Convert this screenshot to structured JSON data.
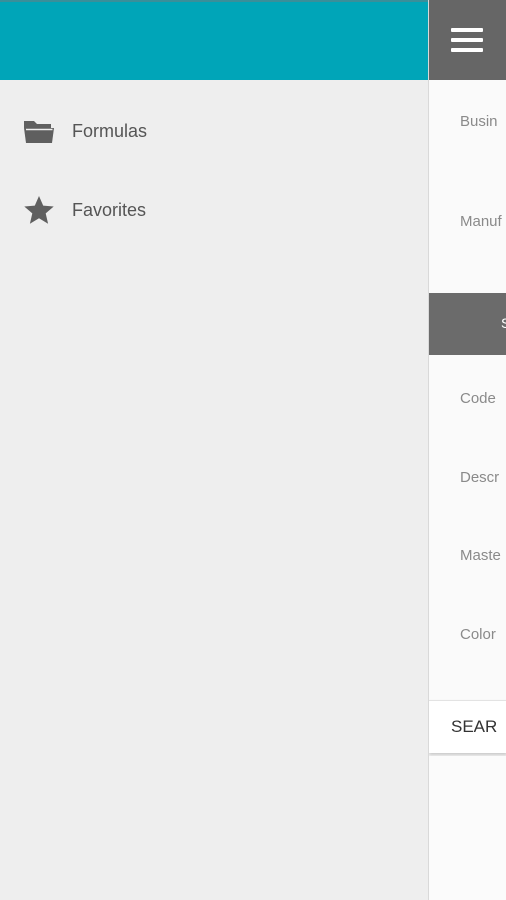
{
  "drawer": {
    "colors": {
      "header": "#00a5b8",
      "background": "#eeeeee",
      "text": "#555555",
      "icon": "#5f5f5f"
    },
    "items": [
      {
        "label": "Formulas",
        "icon": "folder-icon"
      },
      {
        "label": "Favorites",
        "icon": "star-icon"
      }
    ]
  },
  "page": {
    "menu_icon": "hamburger-icon",
    "fields": [
      {
        "label": "Busin"
      },
      {
        "label": "Manuf"
      },
      {
        "label": "Code"
      },
      {
        "label": "Descr"
      },
      {
        "label": "Maste"
      },
      {
        "label": "Color"
      }
    ],
    "section_label": "S",
    "search_label": "SEAR"
  }
}
